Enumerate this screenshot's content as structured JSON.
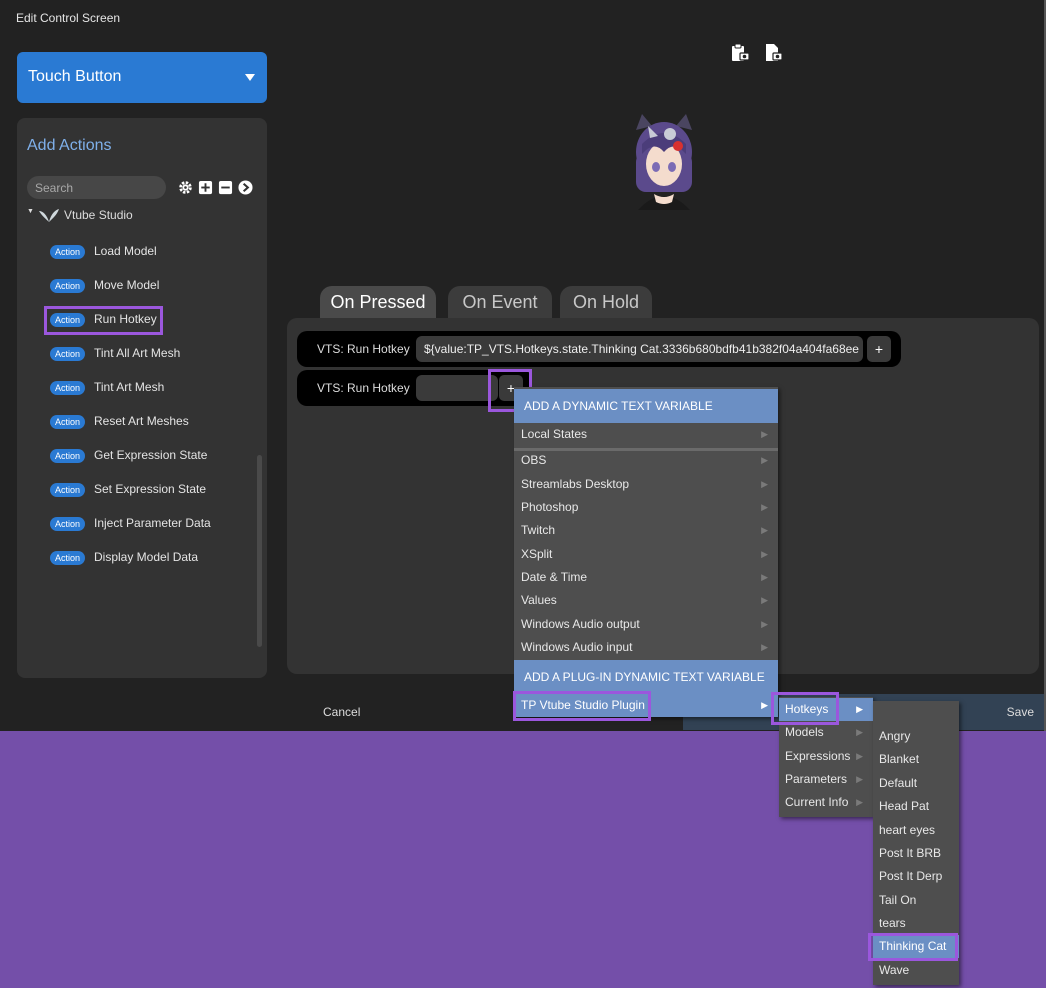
{
  "window": {
    "title": "Edit Control Screen"
  },
  "control_type": {
    "label": "Touch Button"
  },
  "actions_panel": {
    "title": "Add Actions",
    "search_placeholder": "Search",
    "group": "Vtube Studio",
    "badge": "Action",
    "items": [
      {
        "label": "Load Model"
      },
      {
        "label": "Move Model"
      },
      {
        "label": "Run Hotkey",
        "highlighted": true
      },
      {
        "label": "Tint All Art Mesh"
      },
      {
        "label": "Tint Art Mesh"
      },
      {
        "label": "Reset Art Meshes"
      },
      {
        "label": "Get Expression State"
      },
      {
        "label": "Set Expression State"
      },
      {
        "label": "Inject Parameter Data"
      },
      {
        "label": "Display Model Data"
      }
    ]
  },
  "tabs": [
    {
      "label": "On Pressed",
      "active": true
    },
    {
      "label": "On Event",
      "active": false
    },
    {
      "label": "On Hold",
      "active": false
    }
  ],
  "action_rows": [
    {
      "label": "VTS: Run Hotkey",
      "value": "${value:TP_VTS.Hotkeys.state.Thinking Cat.3336b680bdfb41b382f04a404fa68ee",
      "button": "+"
    },
    {
      "label": "VTS: Run Hotkey",
      "value": "",
      "button": "+"
    }
  ],
  "footer": {
    "cancel": "Cancel",
    "save": "Save"
  },
  "dynamic_menu": {
    "header1": "ADD A DYNAMIC TEXT VARIABLE",
    "local_states": "Local States",
    "sources": [
      "OBS",
      "Streamlabs Desktop",
      "Photoshop",
      "Twitch",
      "XSplit",
      "Date & Time",
      "Values",
      "Windows Audio output",
      "Windows Audio input"
    ],
    "header2": "ADD A PLUG-IN DYNAMIC TEXT VARIABLE",
    "plugin": "TP Vtube Studio Plugin"
  },
  "plugin_menu": {
    "items": [
      "Hotkeys",
      "Models",
      "Expressions",
      "Parameters",
      "Current Info"
    ],
    "selected": "Hotkeys"
  },
  "hotkeys_menu": {
    "items": [
      "Angry",
      "Blanket",
      "Default",
      "Head Pat",
      "heart eyes",
      "Post It BRB",
      "Post It Derp",
      "Tail On",
      "tears",
      "Thinking Cat",
      "Wave"
    ],
    "selected": "Thinking Cat"
  },
  "colors": {
    "accent": "#2a7ad3",
    "highlight": "#9b57dd",
    "menu_select": "#6b8fc4",
    "backdrop": "#744fa9"
  }
}
